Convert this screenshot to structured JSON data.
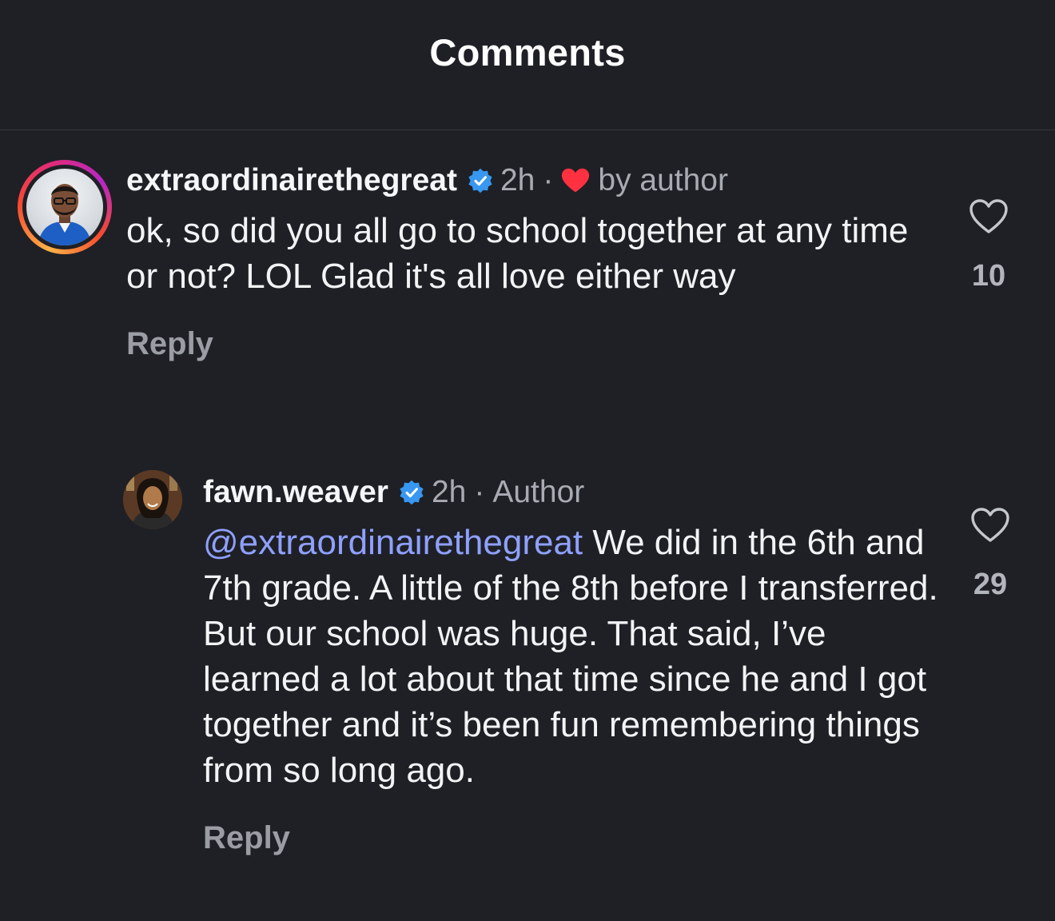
{
  "header": {
    "title": "Comments"
  },
  "comments": [
    {
      "username": "extraordinairethegreat",
      "verified": true,
      "time": "2h",
      "dot": "·",
      "liked_by_author_label": "by author",
      "text": "ok, so did you all go to school together at any time or not? LOL Glad it's all love either way",
      "reply_label": "Reply",
      "like_count": "10",
      "avatar_icon": "profile-photo-man-glasses"
    },
    {
      "username": "fawn.weaver",
      "verified": true,
      "time": "2h",
      "dot": "·",
      "author_label": "Author",
      "mention": "@extraordinairethegreat",
      "text": " We did in the 6th and 7th grade. A little of the 8th before I transferred. But our school was huge. That said, I’ve learned a lot about that time since he and I got together and it’s been fun remembering things from so long ago.",
      "reply_label": "Reply",
      "like_count": "29",
      "avatar_icon": "profile-photo-woman-smiling"
    }
  ],
  "colors": {
    "background": "#1e2025",
    "verified_badge": "#3897f0",
    "heart_red": "#ff3040",
    "mention": "#8fa0ff",
    "muted_text": "#a8abb2"
  }
}
